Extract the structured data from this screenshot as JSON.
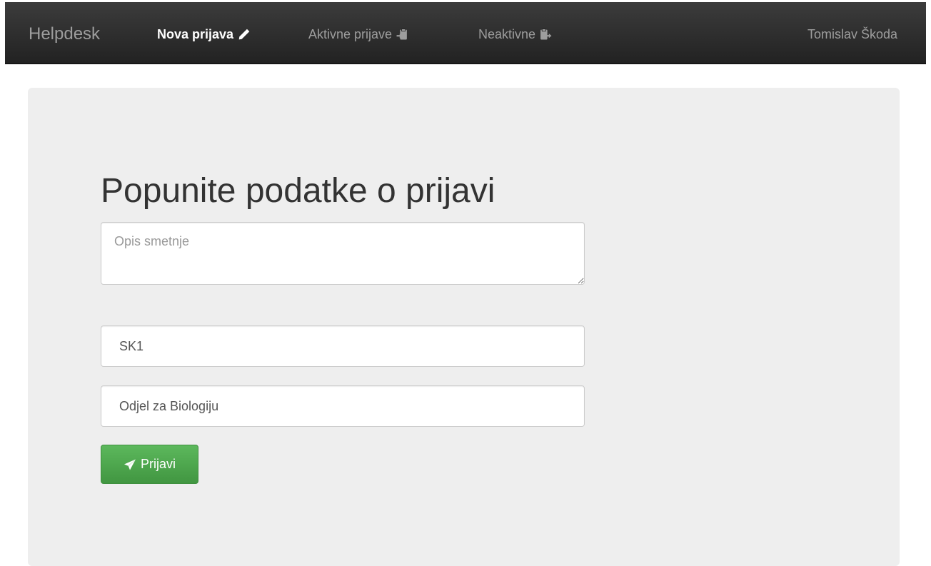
{
  "navbar": {
    "brand": "Helpdesk",
    "items": [
      {
        "label": "Nova prijava",
        "icon": "pencil-icon",
        "active": true
      },
      {
        "label": "Aktivne prijave",
        "icon": "clipboard-import-icon",
        "active": false
      },
      {
        "label": "Neaktivne",
        "icon": "clipboard-export-icon",
        "active": false
      }
    ],
    "user": "Tomislav Škoda"
  },
  "main": {
    "title": "Popunite podatke o prijavi",
    "description": {
      "value": "",
      "placeholder": "Opis smetnje"
    },
    "location": {
      "value": "SK1"
    },
    "department": {
      "value": "Odjel za Biologiju"
    },
    "submit_label": "Prijavi"
  },
  "colors": {
    "navbar_bg": "#222222",
    "jumbotron_bg": "#eeeeee",
    "success": "#5cb85c"
  }
}
